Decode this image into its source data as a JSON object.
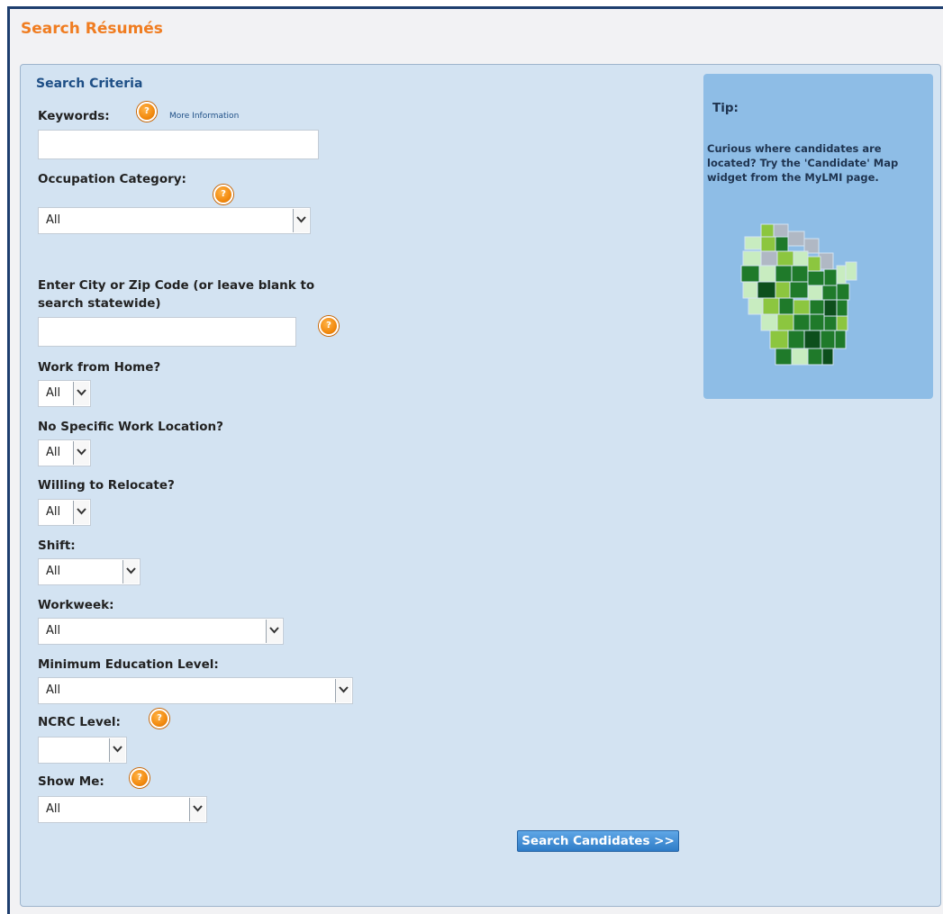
{
  "page": {
    "title": "Search Résumés"
  },
  "form": {
    "section_title": "Search Criteria",
    "keywords": {
      "label": "Keywords:",
      "more_info": "More Information",
      "value": ""
    },
    "occupation": {
      "label": "Occupation Category:",
      "value": "All"
    },
    "location": {
      "label_line1": "Enter City or Zip Code (or leave blank to",
      "label_line2": "search statewide)",
      "value": ""
    },
    "work_from_home": {
      "label": "Work from Home?",
      "value": "All"
    },
    "no_specific_location": {
      "label": "No Specific Work Location?",
      "value": "All"
    },
    "relocate": {
      "label": "Willing to Relocate?",
      "value": "All"
    },
    "shift": {
      "label": "Shift:",
      "value": "All"
    },
    "workweek": {
      "label": "Workweek:",
      "value": "All"
    },
    "education": {
      "label": "Minimum Education Level:",
      "value": "All"
    },
    "ncrc": {
      "label": "NCRC Level:",
      "value": ""
    },
    "show_me": {
      "label": "Show Me:",
      "value": "All"
    },
    "submit_label": "Search Candidates >>"
  },
  "tip": {
    "title": "Tip:",
    "text": "Curious where candidates are located? Try the 'Candidate' Map widget from the MyLMI page."
  },
  "colors": {
    "title_orange": "#f07d21",
    "panel_bg": "#d3e3f2",
    "tip_bg": "#8ebde6",
    "button_blue": "#2f7cc7"
  }
}
